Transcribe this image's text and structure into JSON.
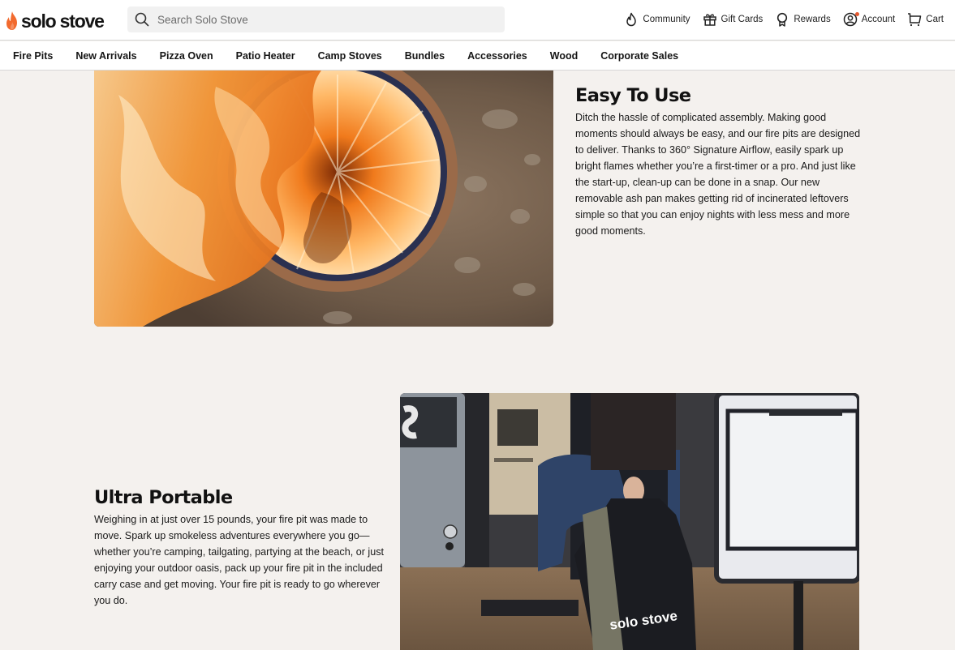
{
  "header": {
    "logo_text": "solo stove",
    "search_placeholder": "Search Solo Stove",
    "utility_links": [
      {
        "label": "Community",
        "icon": "flame-icon"
      },
      {
        "label": "Gift Cards",
        "icon": "gift-icon"
      },
      {
        "label": "Rewards",
        "icon": "rewards-ribbon-icon"
      },
      {
        "label": "Account",
        "icon": "account-icon",
        "notification_dot": true
      },
      {
        "label": "Cart",
        "icon": "cart-icon"
      }
    ]
  },
  "nav": {
    "items": [
      "Fire Pits",
      "New Arrivals",
      "Pizza Oven",
      "Patio Heater",
      "Camp Stoves",
      "Bundles",
      "Accessories",
      "Wood",
      "Corporate Sales"
    ]
  },
  "features": [
    {
      "title": "Easy To Use",
      "body": "Ditch the hassle of complicated assembly. Making good moments should always be easy, and our fire pits are designed to deliver. Thanks to 360° Signature Airflow, easily spark up bright flames whether you’re a first-timer or a pro. And just like the start-up, clean-up can be done in a snap. Our new removable ash pan makes getting rid of incinerated leftovers simple so that you can enjoy nights with less mess and more good moments.",
      "image": "Fire pit with bright orange flames viewed from above on gravel"
    },
    {
      "title": "Ultra Portable",
      "body": "Weighing in at just over 15 pounds, your fire pit was made to move. Spark up smokeless adventures everywhere you go—whether you’re camping, tailgating, partying at the beach, or just enjoying your outdoor oasis, pack up your fire pit in the included carry case and get moving. Your fire pit is ready to go wherever you do.",
      "image": "Person stepping out of a camper carrying a black solo stove carry bag",
      "bag_text": "solo stove"
    }
  ],
  "colors": {
    "brand_orange": "#f26a2e",
    "page_background": "#f4f1ee",
    "notification_dot": "#e4572e"
  }
}
